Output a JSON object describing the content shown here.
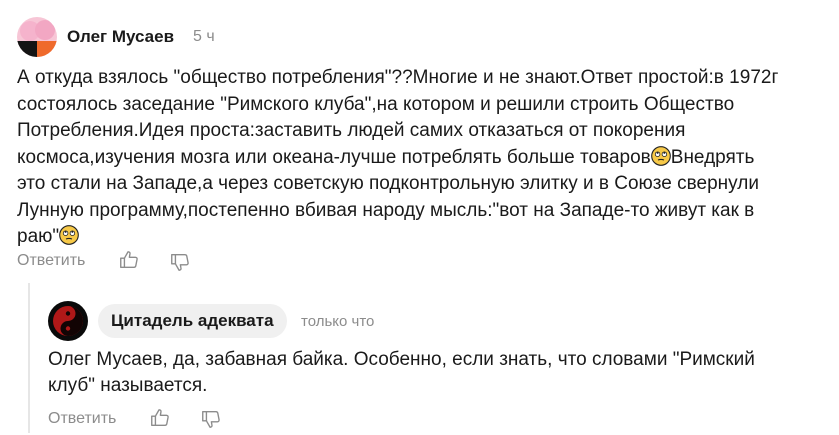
{
  "comment": {
    "author": "Олег Мусаев",
    "time": "5 ч",
    "text_part1": "А откуда взялось \"общество потребления\"??Многие и не знают.Ответ простой:в 1972г\nсостоялось заседание \"Римского клуба\",на котором и решили строить Общество\nПотребления.Идея проста:заставить людей самих отказаться от покорения\nкосмоса,изучения мозга или океана-лучше потреблять больше товаров",
    "text_part2": "Внедрять\nэто стали на Западе,а через советскую подконтрольную элитку и в Союзе свернули\nЛунную программу,постепенно вбивая народу мысль:\"вот на Западе-то живут как в\nраю\"",
    "reply_label": "Ответить",
    "emoji_icon": "face-with-rolling-eyes-icon"
  },
  "reply": {
    "author": "Цитадель адеквата",
    "time": "только что",
    "text": "Олег Мусаев, да, забавная байка. Особенно, если знать, что словами \"Римский\nклуб\" называется.",
    "reply_label": "Ответить"
  },
  "colors": {
    "text": "#1a1a1a",
    "muted": "#8c8c8c",
    "pill_bg": "#f0f0f0",
    "thread_line": "#e6e6e6"
  }
}
